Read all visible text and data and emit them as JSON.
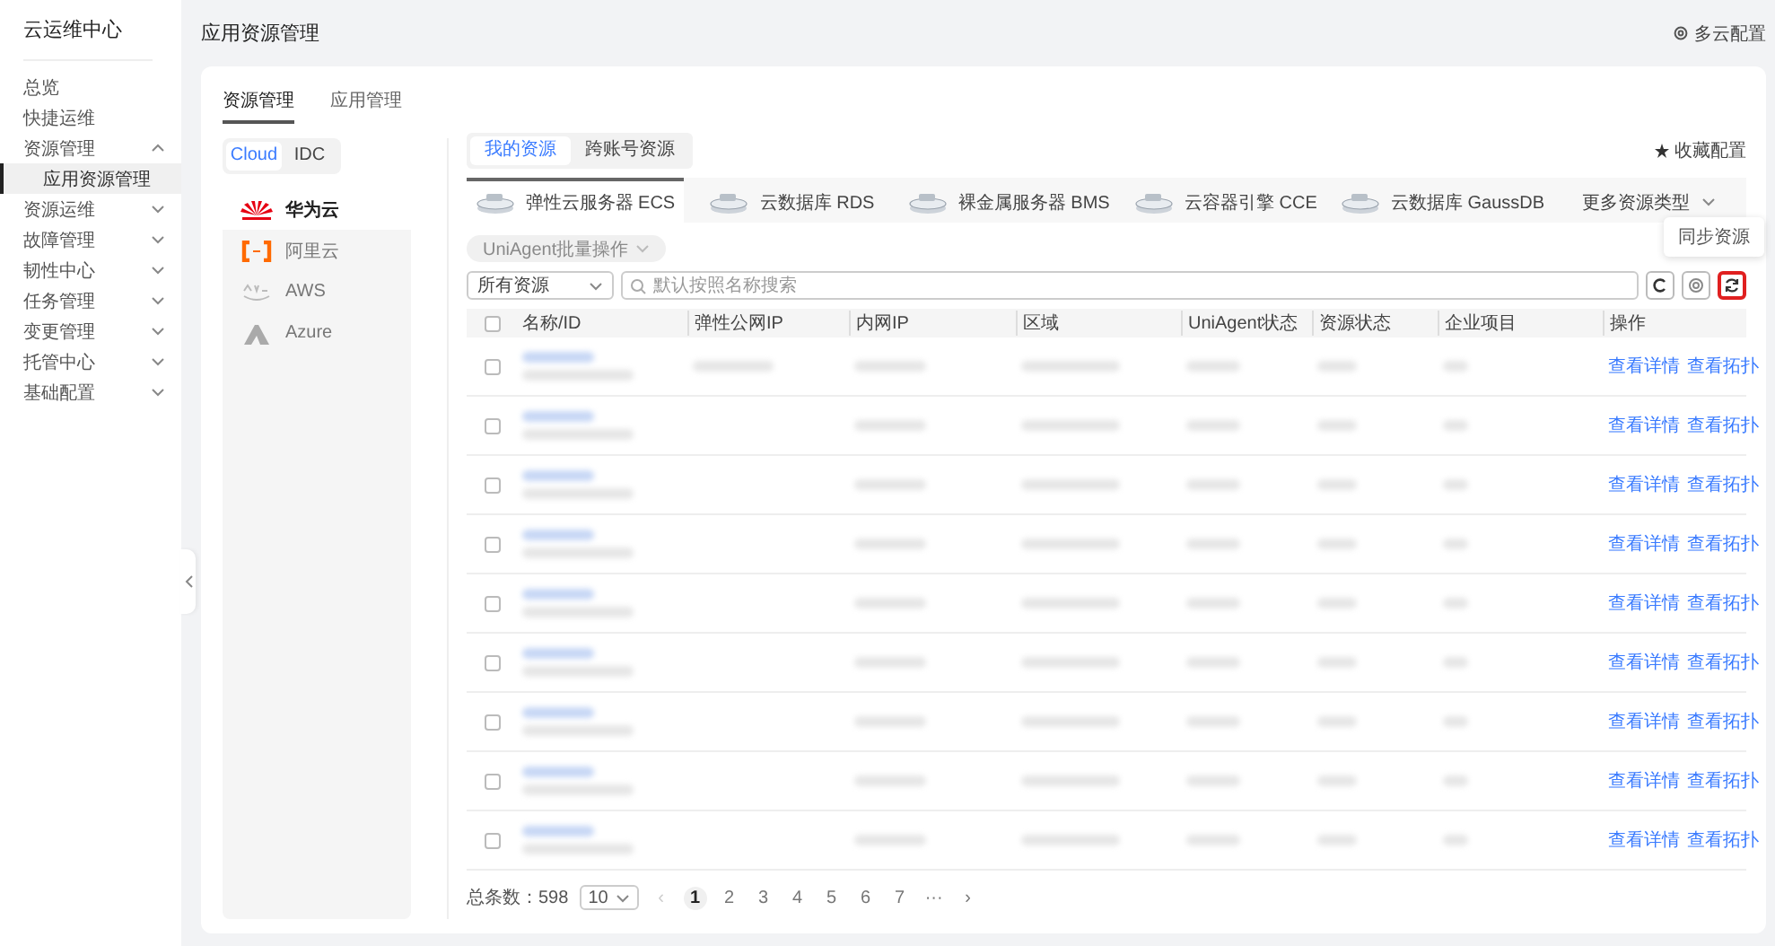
{
  "sidebar": {
    "title": "云运维中心",
    "items": [
      {
        "label": "总览",
        "kind": "link",
        "selected": false
      },
      {
        "label": "快捷运维",
        "kind": "link",
        "selected": false
      },
      {
        "label": "资源管理",
        "kind": "group",
        "expanded": true,
        "selected": false,
        "children": [
          {
            "label": "应用资源管理",
            "kind": "link",
            "selected": true
          }
        ]
      },
      {
        "label": "资源运维",
        "kind": "group",
        "expanded": false,
        "selected": false
      },
      {
        "label": "故障管理",
        "kind": "group",
        "expanded": false,
        "selected": false
      },
      {
        "label": "韧性中心",
        "kind": "group",
        "expanded": false,
        "selected": false
      },
      {
        "label": "任务管理",
        "kind": "group",
        "expanded": false,
        "selected": false
      },
      {
        "label": "变更管理",
        "kind": "group",
        "expanded": false,
        "selected": false
      },
      {
        "label": "托管中心",
        "kind": "group",
        "expanded": false,
        "selected": false
      },
      {
        "label": "基础配置",
        "kind": "group",
        "expanded": false,
        "selected": false
      }
    ]
  },
  "header": {
    "title": "应用资源管理",
    "multi_cloud": "多云配置"
  },
  "main_tabs": [
    {
      "label": "资源管理",
      "selected": true
    },
    {
      "label": "应用管理",
      "selected": false
    }
  ],
  "env_switch": [
    {
      "label": "Cloud",
      "selected": true
    },
    {
      "label": "IDC",
      "selected": false
    }
  ],
  "providers": [
    {
      "label": "华为云",
      "kind": "huawei",
      "selected": true
    },
    {
      "label": "阿里云",
      "kind": "aliyun",
      "selected": false
    },
    {
      "label": "AWS",
      "kind": "aws",
      "selected": false
    },
    {
      "label": "Azure",
      "kind": "azure",
      "selected": false
    }
  ],
  "scope_tabs": [
    {
      "label": "我的资源",
      "selected": true
    },
    {
      "label": "跨账号资源",
      "selected": false
    }
  ],
  "favorite": "收藏配置",
  "resource_tabs": [
    {
      "label": "弹性云服务器 ECS",
      "selected": true
    },
    {
      "label": "云数据库 RDS",
      "selected": false
    },
    {
      "label": "裸金属服务器 BMS",
      "selected": false
    },
    {
      "label": "云容器引擎 CCE",
      "selected": false
    },
    {
      "label": "云数据库 GaussDB",
      "selected": false
    }
  ],
  "more_types": "更多资源类型",
  "batch_button": {
    "label": "UniAgent批量操作",
    "disabled": true
  },
  "filter": {
    "value": "所有资源",
    "placeholder": "默认按照名称搜索"
  },
  "tools": [
    {
      "kind": "refresh",
      "highlighted": false
    },
    {
      "kind": "settings",
      "highlighted": false
    },
    {
      "kind": "sync",
      "highlighted": true
    }
  ],
  "tooltip": "同步资源",
  "table": {
    "select_all_checked": false,
    "columns": [
      "名称/ID",
      "弹性公网IP",
      "内网IP",
      "区域",
      "UniAgent状态",
      "资源状态",
      "企业项目",
      "操作"
    ],
    "rows": [
      {
        "checked": false,
        "actions": [
          "查看详情",
          "查看拓扑"
        ]
      },
      {
        "checked": false,
        "actions": [
          "查看详情",
          "查看拓扑"
        ]
      },
      {
        "checked": false,
        "actions": [
          "查看详情",
          "查看拓扑"
        ]
      },
      {
        "checked": false,
        "actions": [
          "查看详情",
          "查看拓扑"
        ]
      },
      {
        "checked": false,
        "actions": [
          "查看详情",
          "查看拓扑"
        ]
      },
      {
        "checked": false,
        "actions": [
          "查看详情",
          "查看拓扑"
        ]
      },
      {
        "checked": false,
        "actions": [
          "查看详情",
          "查看拓扑"
        ]
      },
      {
        "checked": false,
        "actions": [
          "查看详情",
          "查看拓扑"
        ]
      },
      {
        "checked": false,
        "actions": [
          "查看详情",
          "查看拓扑"
        ]
      }
    ]
  },
  "pagination": {
    "total": "总条数：598",
    "page_size": "10",
    "pages": [
      {
        "label": "1",
        "selected": true
      },
      {
        "label": "2",
        "selected": false
      },
      {
        "label": "3",
        "selected": false
      },
      {
        "label": "4",
        "selected": false
      },
      {
        "label": "5",
        "selected": false
      },
      {
        "label": "6",
        "selected": false
      },
      {
        "label": "7",
        "selected": false
      }
    ],
    "ellipsis": "···",
    "prev": "‹",
    "next": "›"
  }
}
